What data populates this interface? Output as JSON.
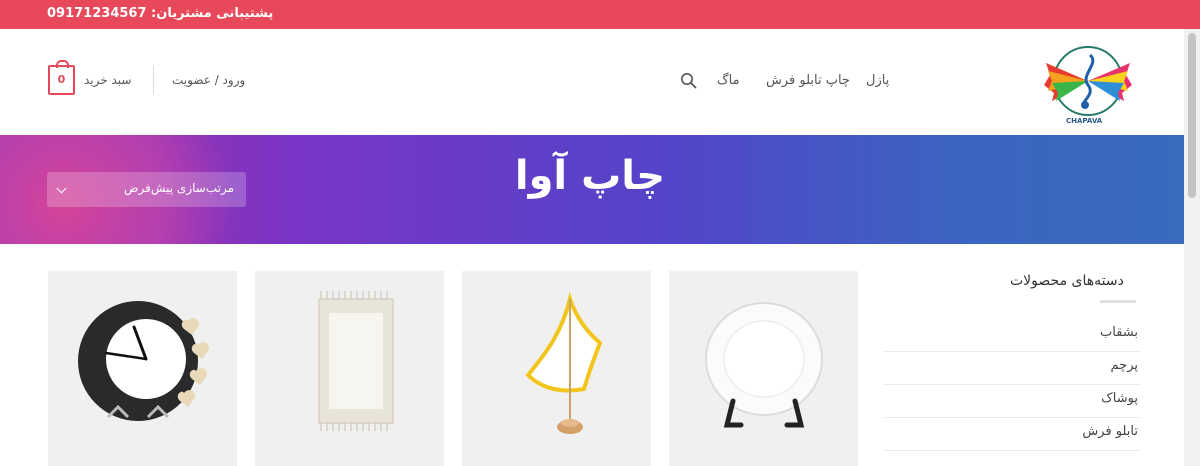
{
  "topbar": {
    "support_text": "پشتیبانی مشتریان: 09171234567"
  },
  "header": {
    "logo_text": "CHAPAVA",
    "nav": [
      {
        "label": "پازل"
      },
      {
        "label": "چاپ تابلو فرش"
      },
      {
        "label": "ماگ"
      }
    ],
    "login_label": "ورود / عضویت",
    "cart_label": "سبد خرید",
    "cart_count": "0"
  },
  "hero": {
    "title": "چاپ آوا",
    "sort_label": "مرتب‌سازی پیش‌فرض"
  },
  "sidebar": {
    "title": "دسته‌های محصولات",
    "items": [
      {
        "label": "بشقاب"
      },
      {
        "label": "پرچم"
      },
      {
        "label": "پوشاک"
      },
      {
        "label": "تابلو فرش"
      }
    ]
  },
  "products": [
    {
      "icon": "plate-icon"
    },
    {
      "icon": "flag-icon"
    },
    {
      "icon": "rug-icon"
    },
    {
      "icon": "clock-icon"
    }
  ],
  "colors": {
    "accent": "#e8495a",
    "hero_start": "#a42fa4",
    "hero_end": "#3a6bbd"
  }
}
